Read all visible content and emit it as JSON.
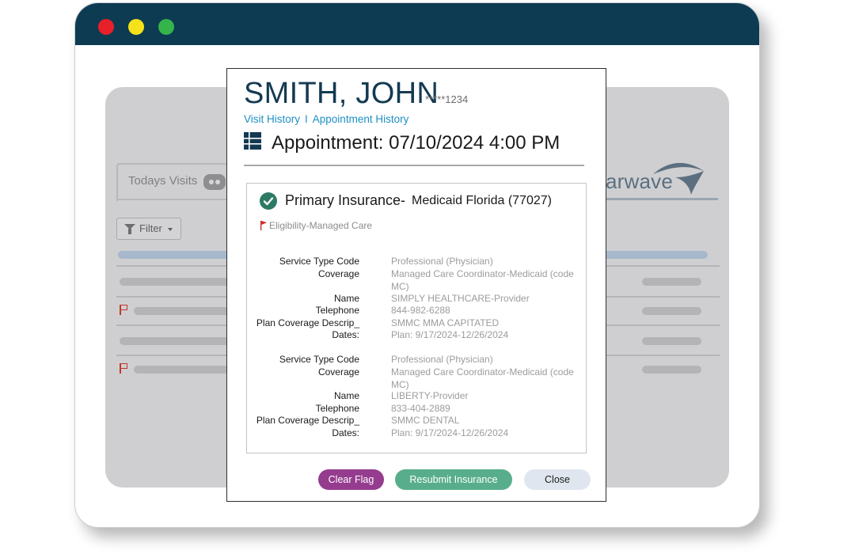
{
  "window": {
    "colors": {
      "titlebar": "#0d3b52",
      "close": "#e8202a",
      "minimize": "#f6e21a",
      "maximize": "#34b44a"
    }
  },
  "background_app": {
    "tab_label": "Todays Visits",
    "filter_label": "Filter",
    "brand_text": "arwave"
  },
  "patient": {
    "name": "SMITH, JOHN",
    "masked_id": "*****1234"
  },
  "links": {
    "visit_history": "Visit History",
    "separator": "I",
    "appointment_history": "Appointment History"
  },
  "appointment": {
    "text": "Appointment: 07/10/2024 4:00 PM"
  },
  "insurance": {
    "label": "Primary Insurance-",
    "value": "Medicaid Florida (77027)",
    "eligibility": "Eligibility-Managed Care",
    "entries": [
      {
        "service_type_label": "Service Type Code",
        "service_type": "Professional (Physician)",
        "coverage_label": "Coverage",
        "coverage": "Managed Care Coordinator-Medicaid (code MC)",
        "name_label": "Name",
        "name": "SIMPLY HEALTHCARE-Provider",
        "telephone_label": "Telephone",
        "telephone": "844-982-6288",
        "plan_label": "Plan Coverage Descrip_",
        "plan": "SMMC MMA CAPITATED",
        "dates_label": "Dates:",
        "dates": "Plan: 9/17/2024-12/26/2024"
      },
      {
        "service_type_label": "Service Type Code",
        "service_type": "Professional (Physician)",
        "coverage_label": "Coverage",
        "coverage": "Managed Care Coordinator-Medicaid (code MC)",
        "name_label": "Name",
        "name": "LIBERTY-Provider",
        "telephone_label": "Telephone",
        "telephone": "833-404-2889",
        "plan_label": "Plan Coverage Descrip_",
        "plan": "SMMC DENTAL",
        "dates_label": "Dates:",
        "dates": "Plan: 9/17/2024-12/26/2024"
      }
    ]
  },
  "buttons": {
    "clear_flag": "Clear Flag",
    "resubmit": "Resubmit Insurance",
    "close": "Close"
  },
  "icons": {
    "eligibility": "red-flag-icon",
    "insurance_status": "check-circle-icon",
    "appointment": "grid-list-icon"
  }
}
